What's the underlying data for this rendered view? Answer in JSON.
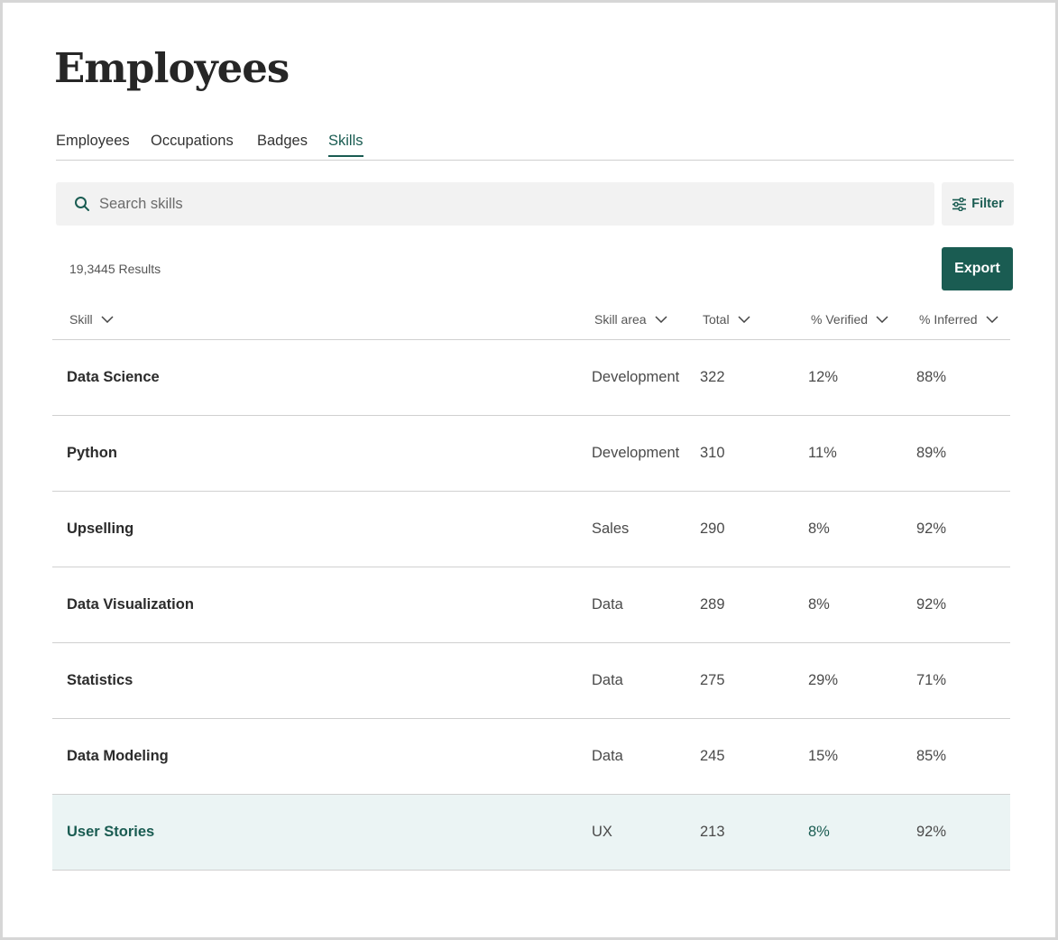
{
  "page": {
    "title": "Employees"
  },
  "tabs": [
    {
      "label": "Employees",
      "active": false
    },
    {
      "label": "Occupations",
      "active": false
    },
    {
      "label": "Badges",
      "active": false
    },
    {
      "label": "Skills",
      "active": true
    }
  ],
  "search": {
    "placeholder": "Search skills",
    "value": "",
    "icon": "search-icon"
  },
  "filter": {
    "label": "Filter",
    "icon": "sliders-icon"
  },
  "results": {
    "label": "19,3445 Results"
  },
  "export": {
    "label": "Export"
  },
  "table": {
    "columns": [
      {
        "label": "Skill",
        "icon": "chevron-down-icon"
      },
      {
        "label": "Skill area",
        "icon": "chevron-down-icon"
      },
      {
        "label": "Total",
        "icon": "chevron-down-icon"
      },
      {
        "label": "% Verified",
        "icon": "chevron-down-icon"
      },
      {
        "label": "% Inferred",
        "icon": "chevron-down-icon"
      }
    ],
    "rows": [
      {
        "skill": "Data Science",
        "area": "Development",
        "total": "322",
        "verified": "12%",
        "inferred": "88%"
      },
      {
        "skill": "Python",
        "area": "Development",
        "total": "310",
        "verified": "11%",
        "inferred": "89%"
      },
      {
        "skill": "Upselling",
        "area": "Sales",
        "total": "290",
        "verified": "8%",
        "inferred": "92%"
      },
      {
        "skill": "Data Visualization",
        "area": "Data",
        "total": "289",
        "verified": "8%",
        "inferred": "92%"
      },
      {
        "skill": "Statistics",
        "area": "Data",
        "total": "275",
        "verified": "29%",
        "inferred": "71%"
      },
      {
        "skill": "Data Modeling",
        "area": "Data",
        "total": "245",
        "verified": "15%",
        "inferred": "85%"
      },
      {
        "skill": "User Stories",
        "area": "UX",
        "total": "213",
        "verified": "8%",
        "inferred": "92%",
        "highlighted": true
      }
    ]
  },
  "colors": {
    "accent": "#1a5c52",
    "highlight_row": "#ebf4f4",
    "input_bg": "#f2f2f2",
    "divider": "#d0d0d0"
  }
}
